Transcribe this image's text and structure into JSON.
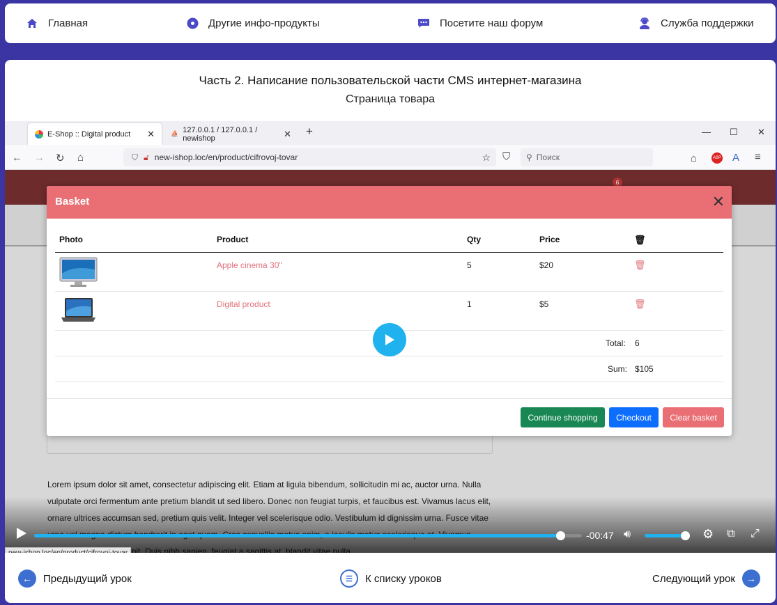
{
  "topnav": {
    "items": [
      {
        "label": "Главная",
        "icon": "home-icon"
      },
      {
        "label": "Другие инфо-продукты",
        "icon": "disc-icon"
      },
      {
        "label": "Посетите наш форум",
        "icon": "chat-icon"
      },
      {
        "label": "Служба поддержки",
        "icon": "support-icon"
      }
    ]
  },
  "lesson": {
    "title": "Часть 2. Написание пользовательской части CMS интернет-магазина",
    "subtitle": "Страница товара"
  },
  "browser": {
    "tabs": [
      {
        "label": "E-Shop :: Digital product"
      },
      {
        "label": "127.0.0.1 / 127.0.0.1 / newishop"
      }
    ],
    "url": "new-ishop.loc/en/product/cifrovoj-tovar",
    "search_placeholder": "Поиск",
    "status_url": "new-ishop.loc/en/product/cifrovoj-tovar",
    "header_badge": "6"
  },
  "modal": {
    "title": "Basket",
    "columns": {
      "photo": "Photo",
      "product": "Product",
      "qty": "Qty",
      "price": "Price"
    },
    "rows": [
      {
        "product": "Apple cinema 30\"",
        "qty": "5",
        "price": "$20"
      },
      {
        "product": "Digital product",
        "qty": "1",
        "price": "$5"
      }
    ],
    "total_label": "Total:",
    "total_value": "6",
    "sum_label": "Sum:",
    "sum_value": "$105",
    "buttons": {
      "continue": "Continue shopping",
      "checkout": "Checkout",
      "clear": "Clear basket"
    }
  },
  "site": {
    "lorem": "Lorem ipsum dolor sit amet, consectetur adipiscing elit. Etiam at ligula bibendum, sollicitudin mi ac, auctor urna. Nulla vulputate orci fermentum ante pretium blandit ut sed libero. Donec non feugiat turpis, et faucibus est. Vivamus lacus elit, ornare ultrices accumsan sed, pretium quis velit. Integer vel scelerisque odio. Vestibulum id dignissim urna. Fusce vitae urna vel magna dictum hendrerit in eget quam. Cras convallis metus enim, a iaculis metus scelerisque at. Vivamus imperdiet tempor suscipit. Duis nibh sapien, feugiat a sagittis at, blandit vitae nulla."
  },
  "player": {
    "time": "-00:47",
    "progress": 0.96,
    "volume": 0.9
  },
  "bottomnav": {
    "prev": "Предыдущий урок",
    "list": "К списку уроков",
    "next": "Следующий урок"
  },
  "colors": {
    "page_bg": "#3b35a3",
    "accent": "#4d49c9",
    "modal_header": "#e96f75",
    "btn_continue": "#198754",
    "btn_checkout": "#0d6efd",
    "btn_clear": "#e96f75",
    "player_accent": "#1fb2ee"
  }
}
